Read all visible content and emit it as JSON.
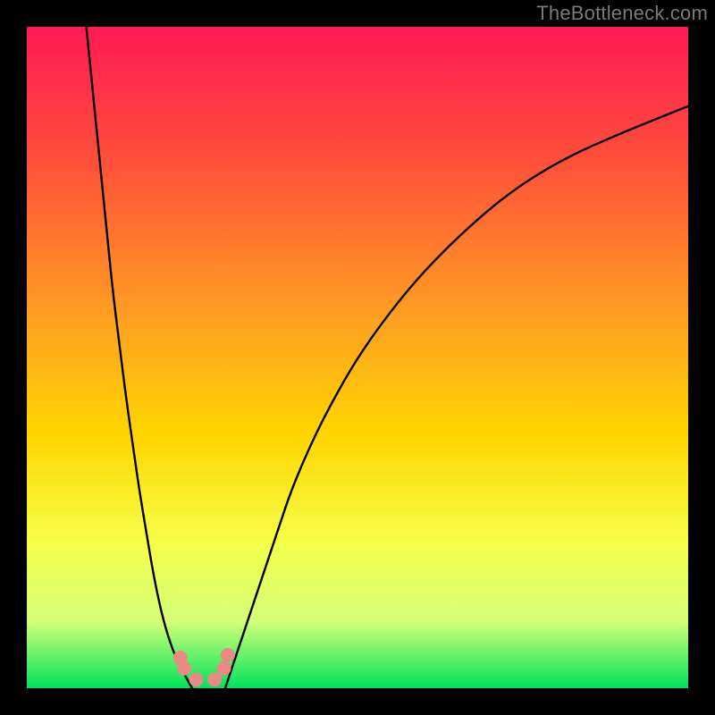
{
  "watermark": "TheBottleneck.com",
  "chart_data": {
    "type": "line",
    "title": "",
    "xlabel": "",
    "ylabel": "",
    "xlim": [
      0,
      100
    ],
    "ylim": [
      0,
      100
    ],
    "gradient_stops": [
      {
        "offset": 0,
        "color": "#ff1a55"
      },
      {
        "offset": 20,
        "color": "#ff4f3a"
      },
      {
        "offset": 45,
        "color": "#ffa321"
      },
      {
        "offset": 62,
        "color": "#ffd600"
      },
      {
        "offset": 78,
        "color": "#f6ff4a"
      },
      {
        "offset": 90,
        "color": "#d3ff7a"
      },
      {
        "offset": 100,
        "color": "#00e35a"
      }
    ],
    "series": [
      {
        "name": "left-curve",
        "x": [
          9,
          10,
          11,
          12,
          13,
          14,
          15,
          16,
          17,
          18,
          19,
          20,
          21,
          22,
          23,
          24,
          25
        ],
        "y": [
          100,
          90,
          80,
          70,
          60,
          52,
          44,
          37,
          30,
          24,
          18,
          13,
          9,
          6,
          3.5,
          1.8,
          0
        ]
      },
      {
        "name": "right-curve",
        "x": [
          30,
          32,
          34,
          36,
          38,
          40,
          43,
          46,
          50,
          55,
          60,
          66,
          73,
          81,
          90,
          100
        ],
        "y": [
          0,
          6,
          12,
          18,
          24,
          30,
          37,
          43,
          50,
          57,
          63,
          69,
          75,
          80,
          84,
          88
        ]
      }
    ],
    "markers": {
      "color": "#e98a85",
      "radius_px": 8,
      "points_xy": [
        [
          23.2,
          4.6
        ],
        [
          23.8,
          3.0
        ],
        [
          25.6,
          1.3
        ],
        [
          28.4,
          1.3
        ],
        [
          29.8,
          3.0
        ],
        [
          30.4,
          5.0
        ]
      ]
    },
    "optimal_x": 27
  }
}
